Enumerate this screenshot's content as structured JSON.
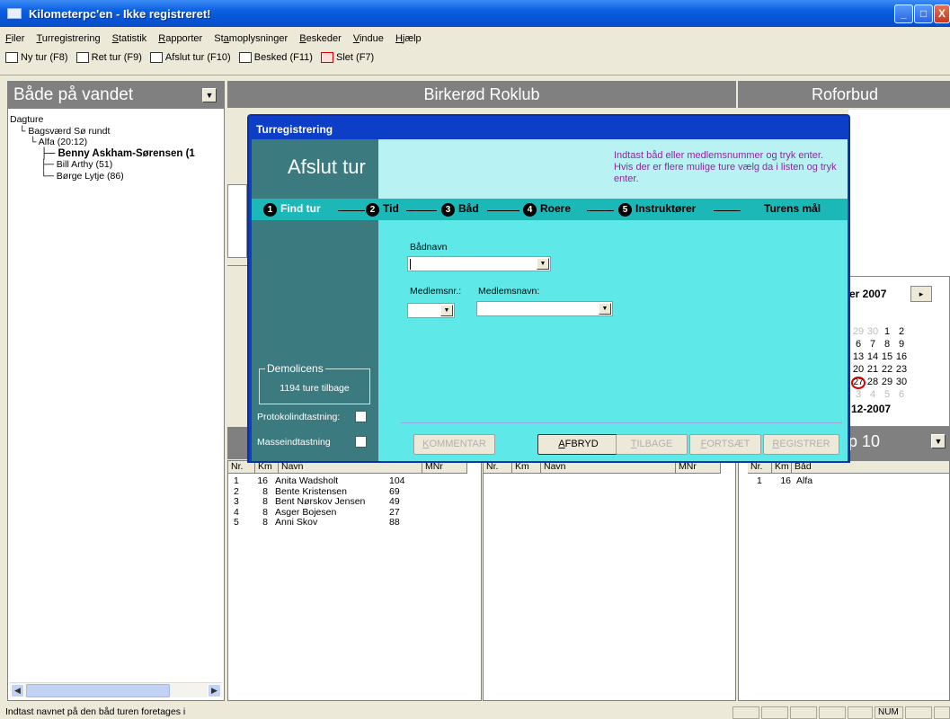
{
  "window": {
    "title": "Kilometerpc'en - Ikke registreret!",
    "controls": [
      "_",
      "□",
      "X"
    ]
  },
  "menu": [
    {
      "acc": "F",
      "rest": "iler"
    },
    {
      "acc": "T",
      "rest": "urregistrering"
    },
    {
      "acc": "S",
      "rest": "tatistik"
    },
    {
      "acc": "R",
      "rest": "apporter"
    },
    {
      "pre": "St",
      "acc": "a",
      "rest": "moplysninger"
    },
    {
      "acc": "B",
      "rest": "eskeder"
    },
    {
      "acc": "V",
      "rest": "indue"
    },
    {
      "acc": "H",
      "rest": "jælp"
    }
  ],
  "toolbar": [
    {
      "label": "Ny tur (F8)",
      "icon": "new-trip-icon"
    },
    {
      "label": "Ret tur (F9)",
      "icon": "edit-trip-icon"
    },
    {
      "label": "Afslut tur (F10)",
      "icon": "finish-trip-icon"
    },
    {
      "label": "Besked (F11)",
      "icon": "message-icon"
    },
    {
      "label": "Slet (F7)",
      "icon": "delete-icon"
    }
  ],
  "left_panel": {
    "title": "Både på vandet",
    "tree": {
      "root": "Dagture",
      "trip": "Bagsværd Sø rundt",
      "boat": "Alfa (20:12)",
      "rowers": [
        "Benny Askham-Sørensen (1",
        "Bill Arthy (51)",
        "Børge Lytje (86)"
      ]
    }
  },
  "center_panel": {
    "title": "Birkerød Roklub"
  },
  "right_panel": {
    "title": "Roforbud"
  },
  "calendar": {
    "month_fragment": "er 2007",
    "next": "▸",
    "rows": [
      [
        "29",
        "30",
        "1",
        "2"
      ],
      [
        "6",
        "7",
        "8",
        "9"
      ],
      [
        "13",
        "14",
        "15",
        "16"
      ],
      [
        "20",
        "21",
        "22",
        "23"
      ],
      [
        "27",
        "28",
        "29",
        "30"
      ],
      [
        "3",
        "4",
        "5",
        "6"
      ]
    ],
    "today_value": "27",
    "today_text": "12-2007"
  },
  "top10": {
    "title": "p 10"
  },
  "list_left": {
    "columns": [
      "Nr.",
      "Km",
      "Navn",
      "MNr"
    ],
    "rows": [
      [
        "1",
        "16",
        "Anita Wadsholt",
        "104"
      ],
      [
        "2",
        "8",
        "Bente Kristensen",
        "69"
      ],
      [
        "3",
        "8",
        "Bent Nørskov Jensen",
        "49"
      ],
      [
        "4",
        "8",
        "Asger Bojesen",
        "27"
      ],
      [
        "5",
        "8",
        "Anni Skov",
        "88"
      ]
    ]
  },
  "list_mid": {
    "columns": [
      "Nr.",
      "Km",
      "Navn",
      "MNr"
    ]
  },
  "list_right": {
    "columns": [
      "Nr.",
      "Km",
      "Båd"
    ],
    "rows": [
      [
        "1",
        "16",
        "Alfa"
      ]
    ]
  },
  "dialog": {
    "title": "Turregistrering",
    "heading": "Afslut tur",
    "instruction": "Indtast båd eller medlemsnummer og tryk enter. Hvis der er flere mulige ture vælg da i listen og tryk enter.",
    "steps": [
      {
        "num": "1",
        "label": "Find tur"
      },
      {
        "num": "2",
        "label": "Tid"
      },
      {
        "num": "3",
        "label": "Båd"
      },
      {
        "num": "4",
        "label": "Roere"
      },
      {
        "num": "5",
        "label": "Instruktører"
      }
    ],
    "goal": "Turens mål",
    "fields": {
      "boat_label": "Bådnavn",
      "member_nr_label": "Medlemsnr.:",
      "member_name_label": "Medlemsnavn:"
    },
    "license": {
      "legend": "Demolicens",
      "text": "1194 ture tilbage"
    },
    "checkboxes": {
      "protocol": "Protokolindtastning:",
      "mass": "Masseindtastning"
    },
    "buttons": [
      {
        "acc": "K",
        "rest": "OMMENTAR",
        "enabled": false
      },
      {
        "acc": "A",
        "rest": "FBRYD",
        "enabled": true
      },
      {
        "acc": "T",
        "rest": "ILBAGE",
        "enabled": false
      },
      {
        "acc": "F",
        "rest": "ORTSÆT",
        "enabled": false
      },
      {
        "acc": "R",
        "rest": "EGISTRER",
        "enabled": false
      }
    ]
  },
  "status": {
    "text": "Indtast navnet på den båd turen foretages i",
    "num": "NUM"
  }
}
